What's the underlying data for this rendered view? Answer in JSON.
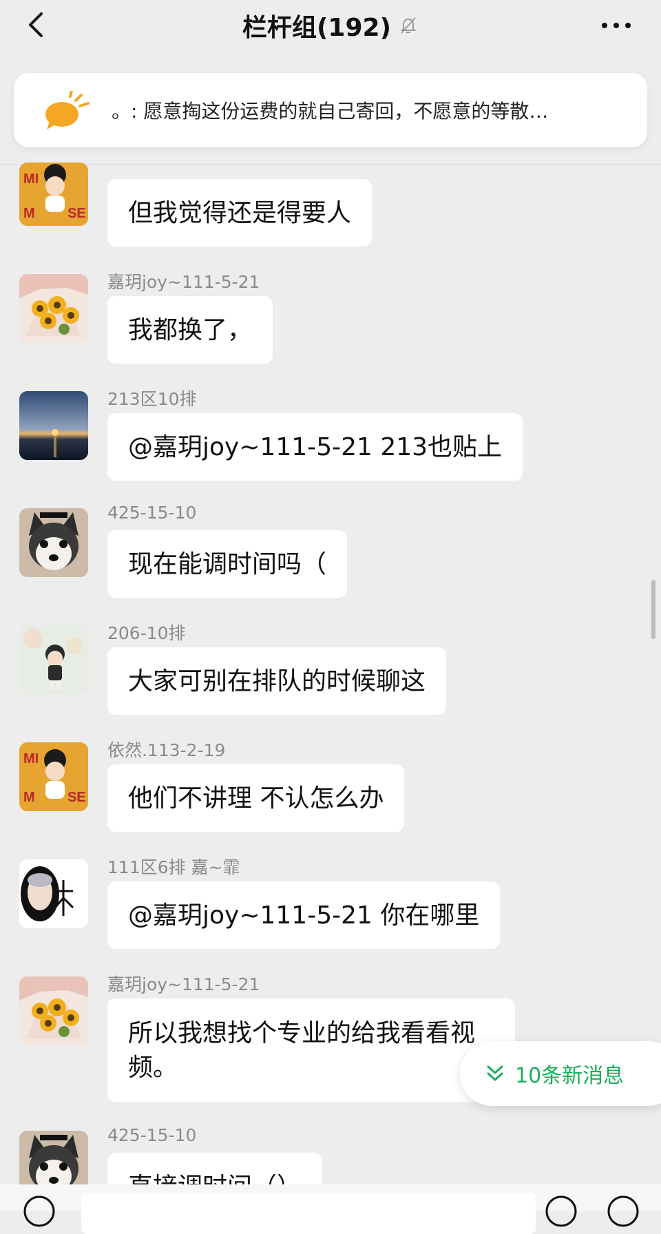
{
  "header": {
    "title": "栏杆组(192)",
    "back_icon": "chevron-left-icon",
    "mute_icon": "bell-off-icon",
    "more_icon": "more-dots-icon"
  },
  "notice": {
    "icon": "announcement-bubble-icon",
    "text": "。: 愿意掏这份运费的就自己寄回，不愿意的等散…"
  },
  "messages": [
    {
      "sender": "",
      "text": "但我觉得还是得要人",
      "avatar": "mickey-cartoon"
    },
    {
      "sender": "嘉玥joy~111-5-21",
      "text": "我都换了，",
      "avatar": "sunflower-bouquet"
    },
    {
      "sender": "213区10排",
      "text": "@嘉玥joy~111-5-21 213也贴上",
      "avatar": "sunset-lake"
    },
    {
      "sender": "425-15-10",
      "text": "现在能调时间吗（",
      "avatar": "husky-dog"
    },
    {
      "sender": "206-10排",
      "text": "大家可别在排队的时候聊这",
      "avatar": "cartoon-boy"
    },
    {
      "sender": "依然.113-2-19",
      "text": "他们不讲理 不认怎么办",
      "avatar": "mickey-cartoon"
    },
    {
      "sender": "111区6排 嘉~霏",
      "text": "@嘉玥joy~111-5-21 你在哪里",
      "avatar": "selfie-mi"
    },
    {
      "sender": "嘉玥joy~111-5-21",
      "text": "所以我想找个专业的给我看看视\n频。",
      "avatar": "sunflower-bouquet"
    },
    {
      "sender": "425-15-10",
      "text": "直接调时间（）",
      "avatar": "husky-dog"
    }
  ],
  "new_messages": {
    "icon": "double-chevron-down-icon",
    "label": "10条新消息",
    "color": "#1aad5a"
  },
  "input_bar": {
    "left_icon": "voice-icon",
    "right_icons": [
      "emoji-icon",
      "plus-icon"
    ]
  }
}
